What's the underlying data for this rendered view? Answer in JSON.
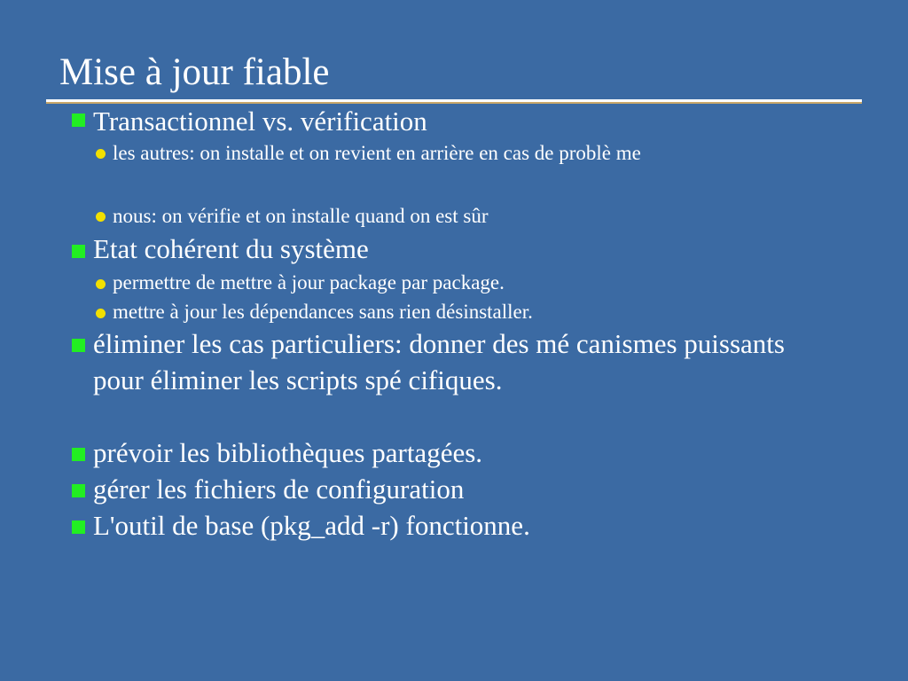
{
  "slide": {
    "title": "Mise à jour fiable",
    "items": [
      {
        "text": "Transactionnel vs. vérification",
        "subitems": [
          "les autres: on installe et on revient en arrière en cas de problè me",
          "nous: on vérifie et on installe quand on est sûr"
        ]
      },
      {
        "text": "Etat cohérent du système",
        "subitems": [
          "permettre de mettre à jour package par package.",
          "mettre à jour les dépendances sans rien désinstaller."
        ]
      },
      {
        "text": "éliminer les cas particuliers: donner des mé canismes puissants pour  éliminer les scripts spé cifiques."
      },
      {
        "text": "prévoir les bibliothèques partagées."
      },
      {
        "text": "gérer les fichiers de configuration"
      },
      {
        "text": "L'outil de base (pkg_add -r) fonctionne."
      }
    ]
  },
  "colors": {
    "background": "#3b6aa3",
    "bullet_level1": "#22ee22",
    "bullet_level2": "#f2e000",
    "text": "#ffffff"
  }
}
